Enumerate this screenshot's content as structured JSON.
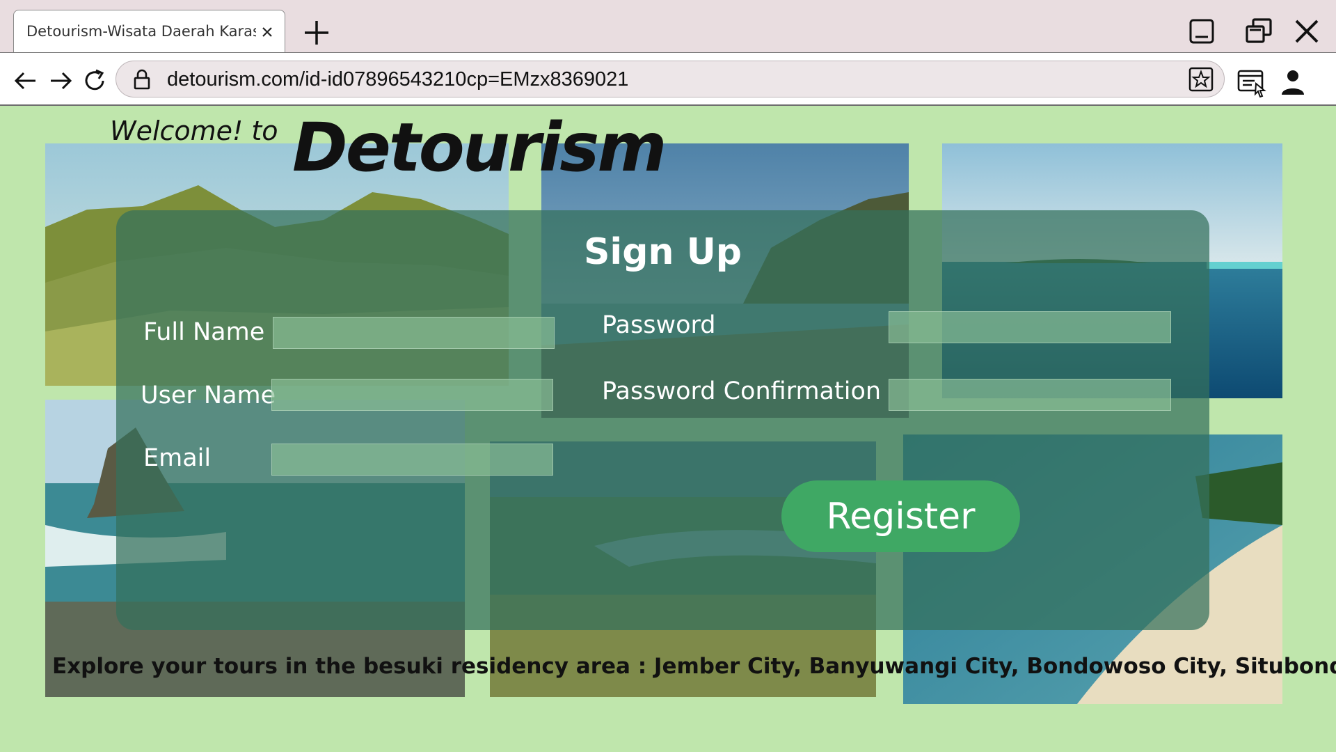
{
  "browser": {
    "tab_title": "Detourism-Wisata Daerah Karasid",
    "url": "detourism.com/id-id07896543210cp=EMzx8369021",
    "icons": [
      "close-tab-icon",
      "new-tab-icon",
      "minimize-icon",
      "restore-icon",
      "close-window-icon",
      "back-arrow-icon",
      "forward-arrow-icon",
      "reload-icon",
      "lock-icon",
      "favorite-star-icon",
      "collections-icon",
      "profile-icon"
    ]
  },
  "header": {
    "welcome": "Welcome! to",
    "brand": "Detourism"
  },
  "form": {
    "title": "Sign Up",
    "full_name_label": "Full Name",
    "user_name_label": "User Name",
    "email_label": "Email",
    "password_label": "Password",
    "password_confirmation_label": "Password Confirmation",
    "full_name_value": "",
    "user_name_value": "",
    "email_value": "",
    "password_value": "",
    "password_confirmation_value": "",
    "register_label": "Register"
  },
  "footer": {
    "text": "Explore your tours in the besuki residency area : Jember City, Banyuwangi City, Bondowoso City, Situbondo City"
  },
  "colors": {
    "page_background": "#bfe6ac",
    "panel": "#34705c",
    "register_button": "#3fa864",
    "tab_strip": "#e9dde0"
  }
}
